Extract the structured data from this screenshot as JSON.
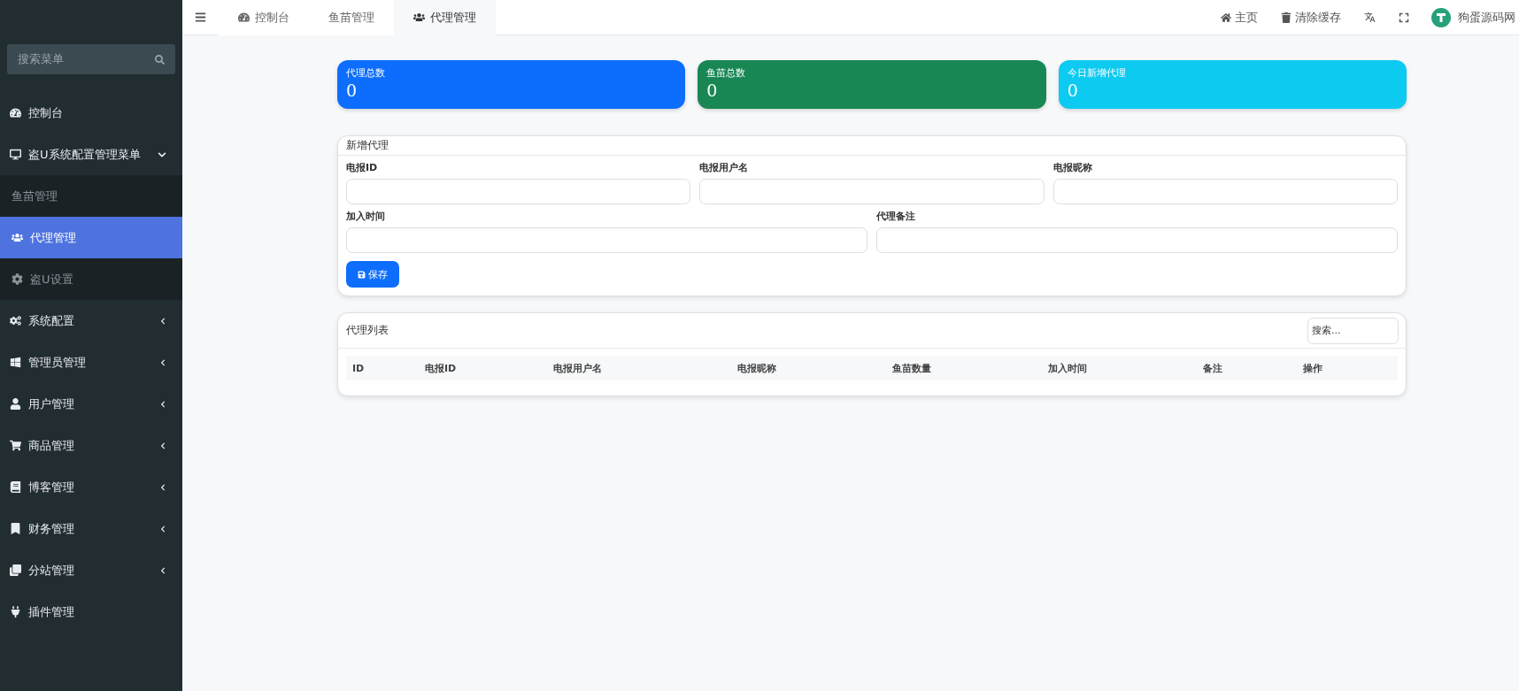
{
  "sidebar": {
    "search": {
      "placeholder": "搜索菜单"
    },
    "items": [
      {
        "label": "控制台",
        "selected": false
      },
      {
        "label": "盗U系统配置管理菜单",
        "expanded": true,
        "selected": false,
        "children": [
          {
            "label": "鱼苗管理",
            "selected": false
          },
          {
            "label": "代理管理",
            "selected": true
          },
          {
            "label": "盗U设置",
            "selected": false
          }
        ]
      },
      {
        "label": "系统配置",
        "expanded": false,
        "selected": false
      },
      {
        "label": "管理员管理",
        "expanded": false,
        "selected": false
      },
      {
        "label": "用户管理",
        "expanded": false,
        "selected": false
      },
      {
        "label": "商品管理",
        "expanded": false,
        "selected": false
      },
      {
        "label": "博客管理",
        "expanded": false,
        "selected": false
      },
      {
        "label": "财务管理",
        "expanded": false,
        "selected": false
      },
      {
        "label": "分站管理",
        "expanded": false,
        "selected": false
      },
      {
        "label": "插件管理",
        "selected": false
      }
    ]
  },
  "header": {
    "tabs": [
      {
        "label": "控制台",
        "selected": false
      },
      {
        "label": "鱼苗管理",
        "selected": false
      },
      {
        "label": "代理管理",
        "selected": true
      }
    ],
    "links": [
      "主页",
      "清除缓存"
    ],
    "user": {
      "name": "狗蛋源码网"
    }
  },
  "stats": [
    {
      "label": "代理总数",
      "value": "0",
      "color": "#0d6efd"
    },
    {
      "label": "鱼苗总数",
      "value": "0",
      "color": "#198754"
    },
    {
      "label": "今日新增代理",
      "value": "0",
      "color": "#0dcaf0"
    }
  ],
  "form": {
    "title": "新增代理",
    "rows": [
      [
        {
          "label": "电报ID"
        },
        {
          "label": "电报用户名"
        },
        {
          "label": "电报昵称"
        }
      ],
      [
        {
          "label": "加入时间"
        },
        {
          "label": "代理备注"
        }
      ]
    ],
    "save_button": "保存"
  },
  "table": {
    "title": "代理列表",
    "search": {
      "placeholder": "搜索..."
    },
    "columns": [
      "ID",
      "电报ID",
      "电报用户名",
      "电报昵称",
      "鱼苗数量",
      "加入时间",
      "备注",
      "操作"
    ]
  }
}
